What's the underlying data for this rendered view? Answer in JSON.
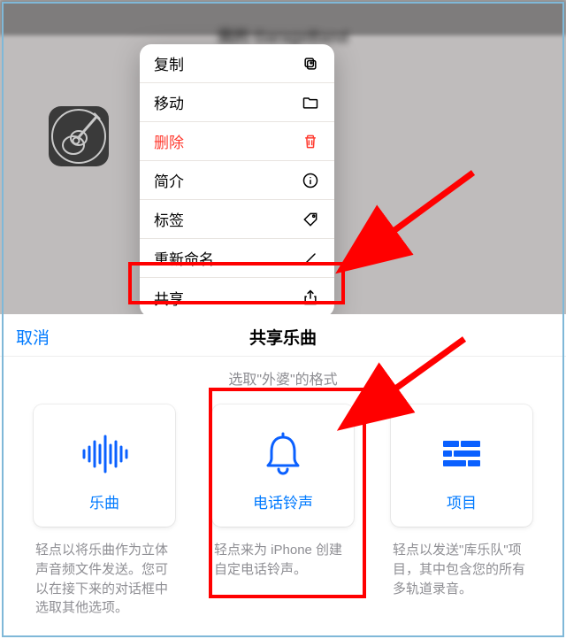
{
  "top": {
    "blurred_title": "我的 GarageBand"
  },
  "context_menu": {
    "copy": "复制",
    "move": "移动",
    "delete": "删除",
    "info": "简介",
    "tags": "标签",
    "rename": "重新命名",
    "share": "共享"
  },
  "share_sheet": {
    "cancel": "取消",
    "title": "共享乐曲",
    "subtitle": "选取\"外婆\"的格式",
    "options": {
      "song": {
        "label": "乐曲",
        "desc": "轻点以将乐曲作为立体声音频文件发送。您可以在接下来的对话框中选取其他选项。"
      },
      "ringtone": {
        "label": "电话铃声",
        "desc": "轻点来为 iPhone 创建自定电话铃声。"
      },
      "project": {
        "label": "项目",
        "desc": "轻点以发送\"库乐队\"项目，其中包含您的所有多轨道录音。"
      }
    }
  }
}
